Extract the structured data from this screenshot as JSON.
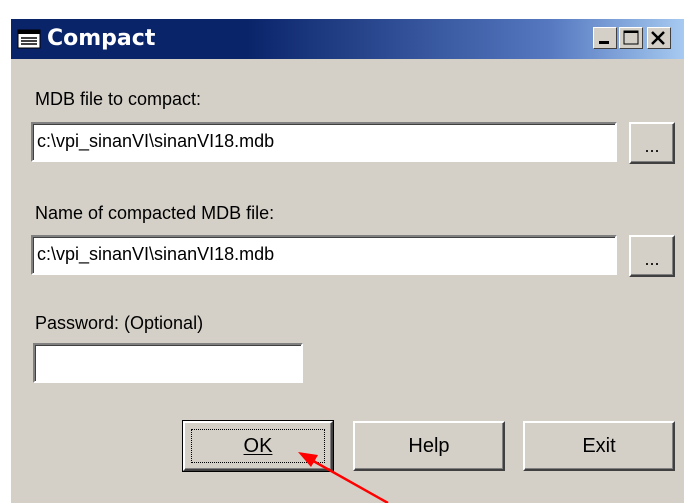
{
  "window": {
    "title": "Compact",
    "colors": {
      "titlebar": "#0a246a",
      "face": "#d4d0c8"
    }
  },
  "form": {
    "mdb_label": "MDB file to compact:",
    "mdb_value": "c:\\vpi_sinanVI\\sinanVI18.mdb",
    "compacted_label": "Name of compacted MDB file:",
    "compacted_value": "c:\\vpi_sinanVI\\sinanVI18.mdb",
    "password_label": "Password: (Optional)",
    "password_value": "",
    "browse_label": "..."
  },
  "buttons": {
    "ok": "OK",
    "help": "Help",
    "exit": "Exit"
  },
  "annotation": {
    "arrow_color": "#ff0000"
  }
}
